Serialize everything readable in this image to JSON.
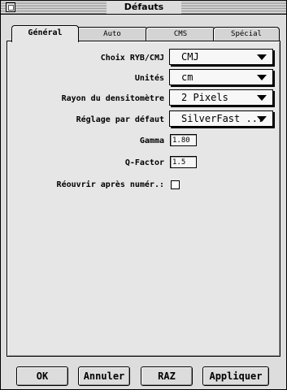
{
  "window": {
    "title": "Défauts"
  },
  "tabs": [
    {
      "label": "Général",
      "active": true
    },
    {
      "label": "Auto"
    },
    {
      "label": "CMS"
    },
    {
      "label": "Spécial"
    }
  ],
  "settings": {
    "choix": {
      "label": "Choix RYB/CMJ",
      "value": "CMJ"
    },
    "unites": {
      "label": "Unités",
      "value": "cm"
    },
    "rayon": {
      "label": "Rayon du densitomètre",
      "value": "2 Pixels"
    },
    "reglage": {
      "label": "Réglage par défaut",
      "value": "SilverFast ..."
    },
    "gamma": {
      "label": "Gamma",
      "value": "1.80"
    },
    "qfactor": {
      "label": "Q-Factor",
      "value": "1.5"
    },
    "reouvrir": {
      "label": "Réouvrir après numér.:",
      "checked": false
    }
  },
  "buttons": {
    "ok": "OK",
    "annuler": "Annuler",
    "raz": "RAZ",
    "appliquer": "Appliquer"
  }
}
